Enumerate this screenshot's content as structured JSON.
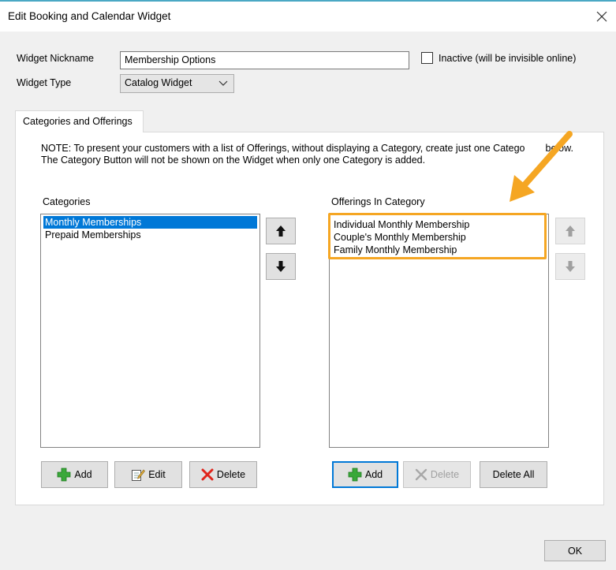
{
  "window": {
    "title": "Edit Booking and Calendar Widget",
    "close_icon": "close-icon"
  },
  "form": {
    "nickname_label": "Widget Nickname",
    "nickname_value": "Membership Options",
    "inactive_label": "Inactive (will be invisible online)",
    "inactive_checked": false,
    "type_label": "Widget Type",
    "type_value": "Catalog Widget"
  },
  "tabs": [
    {
      "label": "Categories and Offerings",
      "active": true
    }
  ],
  "note": {
    "line1": "NOTE: To present your customers with a list of Offerings, without displaying a Category, create just one Catego",
    "line1_end": "below.",
    "line2": "The Category Button will not be shown on the Widget when only one Category is added."
  },
  "categories": {
    "label": "Categories",
    "items": [
      {
        "label": "Monthly Memberships",
        "selected": true
      },
      {
        "label": "Prepaid Memberships",
        "selected": false
      }
    ],
    "buttons": {
      "add": "Add",
      "edit": "Edit",
      "delete": "Delete"
    }
  },
  "offerings": {
    "label": "Offerings In Category",
    "items": [
      {
        "label": "Individual Monthly Membership"
      },
      {
        "label": "Couple's Monthly Membership"
      },
      {
        "label": "Family Monthly Membership"
      }
    ],
    "buttons": {
      "add": "Add",
      "delete": "Delete",
      "delete_all": "Delete All"
    }
  },
  "footer": {
    "ok": "OK"
  },
  "colors": {
    "accent": "#0078d7",
    "highlight": "#f5a623",
    "add_icon": "#3aa83a",
    "delete_icon": "#e0241b"
  }
}
